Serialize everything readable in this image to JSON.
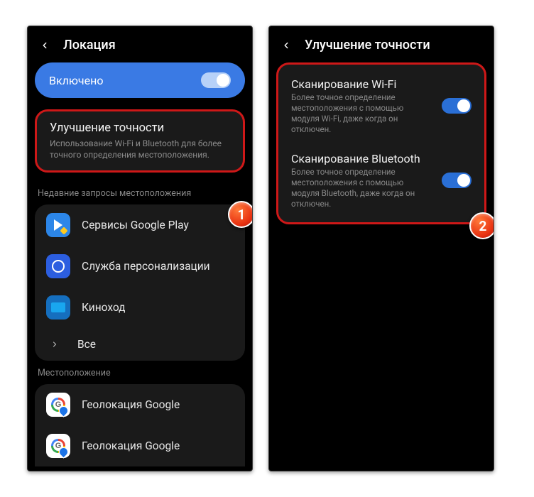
{
  "left": {
    "header": {
      "title": "Локация"
    },
    "toggle": {
      "label": "Включено"
    },
    "accuracy": {
      "title": "Улучшение точности",
      "desc": "Использование Wi-Fi и Bluetooth для более точного определения местоположения."
    },
    "recent_label": "Недавние запросы местоположения",
    "apps": [
      {
        "name": "Сервисы Google Play"
      },
      {
        "name": "Служба персонализации"
      },
      {
        "name": "Киноход"
      }
    ],
    "all_label": "Все",
    "loc_label": "Местоположение",
    "loc_items": [
      {
        "name": "Геолокация Google"
      },
      {
        "name": "Геолокация Google"
      }
    ],
    "badge": "1"
  },
  "right": {
    "header": {
      "title": "Улучшение точности"
    },
    "scans": [
      {
        "title": "Сканирование Wi-Fi",
        "desc": "Более точное определение местоположения с помощью модуля Wi-Fi, даже когда он отключен."
      },
      {
        "title": "Сканирование Bluetooth",
        "desc": "Более точное определение местоположения с помощью модуля Bluetooth, даже когда он отключен."
      }
    ],
    "badge": "2"
  }
}
